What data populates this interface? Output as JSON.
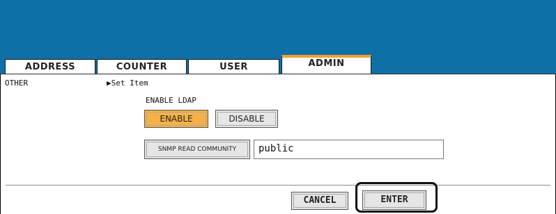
{
  "tabs": [
    {
      "label": "ADDRESS"
    },
    {
      "label": "COUNTER"
    },
    {
      "label": "USER"
    },
    {
      "label": "ADMIN",
      "active": true
    }
  ],
  "left_menu": {
    "item": "OTHER"
  },
  "set_item": {
    "arrow": "▶",
    "label": "Set Item"
  },
  "ldap": {
    "title": "ENABLE LDAP",
    "enable_label": "ENABLE",
    "disable_label": "DISABLE",
    "selected": "ENABLE"
  },
  "snmp": {
    "button_label": "SNMP READ COMMUNITY",
    "value": "public"
  },
  "footer": {
    "cancel_label": "CANCEL",
    "enter_label": "ENTER"
  },
  "colors": {
    "header": "#0f70a8",
    "active_tab_accent": "#f0a030",
    "selected_button": "#f6b146"
  }
}
